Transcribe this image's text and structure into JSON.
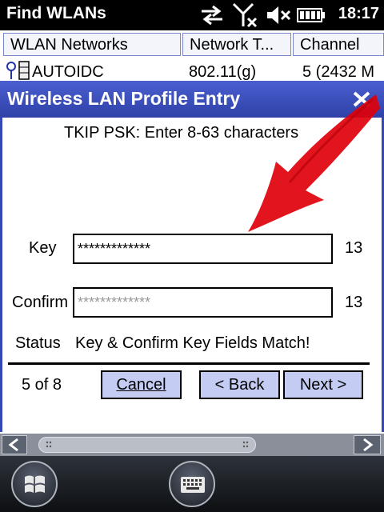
{
  "status_bar": {
    "title": "Find WLANs",
    "time": "18:17",
    "icons": [
      "sync-arrows-icon",
      "no-signal-icon",
      "speaker-muted-icon",
      "battery-icon"
    ]
  },
  "list": {
    "columns": [
      "WLAN Networks",
      "Network T...",
      "Channel"
    ],
    "rows": [
      {
        "name": "AUTOIDC",
        "type": "802.11(g)",
        "channel": "5 (2432 M"
      }
    ]
  },
  "dialog": {
    "title": "Wireless LAN Profile Entry",
    "instruction": "TKIP PSK: Enter 8-63 characters",
    "key_label": "Key",
    "key_value": "*************",
    "key_count": "13",
    "confirm_label": "Confirm",
    "confirm_value": "*************",
    "confirm_count": "13",
    "status_label": "Status",
    "status_text": "Key & Confirm Key Fields Match!",
    "page_indicator": "5 of 8",
    "cancel_label": "Cancel",
    "back_label": "< Back",
    "next_label": "Next >"
  },
  "colors": {
    "dialog_title_bar": "#3548b5",
    "button_fill": "#c4ccf3",
    "annotation_arrow": "#e0000a"
  }
}
